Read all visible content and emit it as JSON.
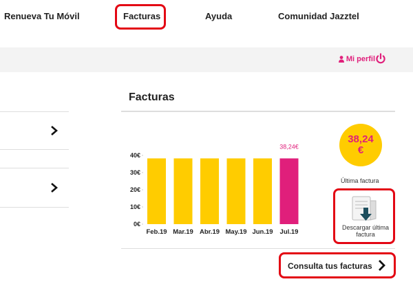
{
  "nav": {
    "renueva": "Renueva Tu Móvil",
    "facturas": "Facturas",
    "ayuda": "Ayuda",
    "comunidad": "Comunidad Jazztel"
  },
  "subbar": {
    "perfil": "Mi perfil"
  },
  "section": {
    "title": "Facturas"
  },
  "chart_data": {
    "type": "bar",
    "categories": [
      "Feb.19",
      "Mar.19",
      "Abr.19",
      "May.19",
      "Jun.19",
      "Jul.19"
    ],
    "values": [
      38.24,
      38.24,
      38.24,
      38.24,
      38.24,
      38.24
    ],
    "highlight_label": "38,24€",
    "ylim": [
      0,
      40
    ],
    "yticks": [
      "0€",
      "10€",
      "20€",
      "30€",
      "40€"
    ],
    "colors": {
      "bar": "#ffcc00",
      "last": "#e01f7b"
    }
  },
  "summary": {
    "amount": "38,24",
    "currency": "€",
    "caption": "Última factura"
  },
  "download": {
    "label": "Descargar última factura"
  },
  "consulta": {
    "label": "Consulta tus facturas"
  },
  "colors": {
    "accent": "#e01f7b",
    "highlight": "#e30613",
    "bar": "#ffcc00"
  }
}
